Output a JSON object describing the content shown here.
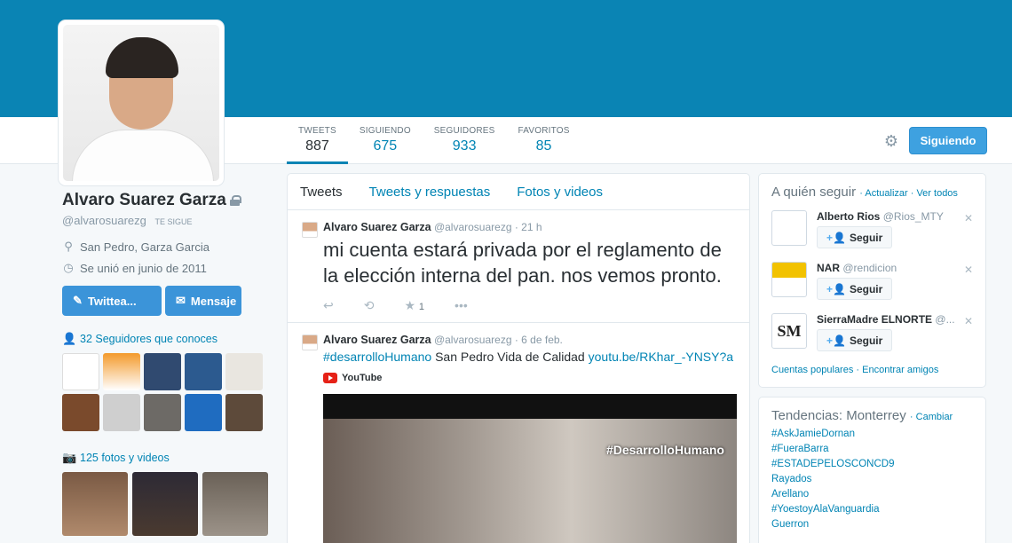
{
  "colors": {
    "banner": "#0a84b4",
    "accent": "#0084b4",
    "button": "#3b94d9"
  },
  "profile": {
    "name": "Alvaro Suarez Garza",
    "handle": "@alvarosuarezg",
    "follows_you": "TE SIGUE",
    "location": "San Pedro, Garza Garcia",
    "joined": "Se unió en junio de 2011",
    "tweet_button": "Twittea...",
    "message_button": "Mensaje",
    "known_followers": "32 Seguidores que conoces",
    "photos_videos": "125 fotos y videos"
  },
  "stats": [
    {
      "label": "TWEETS",
      "value": "887"
    },
    {
      "label": "SIGUIENDO",
      "value": "675"
    },
    {
      "label": "SEGUIDORES",
      "value": "933"
    },
    {
      "label": "FAVORITOS",
      "value": "85"
    }
  ],
  "header": {
    "following_button": "Siguiendo",
    "settings_icon": "gear-icon"
  },
  "tabs": [
    "Tweets",
    "Tweets y respuestas",
    "Fotos y videos"
  ],
  "tweets": [
    {
      "name": "Alvaro Suarez Garza",
      "handle": "@alvarosuarezg",
      "time": "· 21 h",
      "text": "mi cuenta estará privada por el reglamento de la elección interna del pan. nos vemos pronto.",
      "favorites": "1"
    },
    {
      "name": "Alvaro Suarez Garza",
      "handle": "@alvarosuarezg",
      "time": "· 6 de feb.",
      "hashtag": "#desarrolloHumano",
      "text": "San Pedro Vida de Calidad",
      "link": "youtu.be/RKhar_-YNSY?a",
      "source": "YouTube",
      "video_tag": "#DesarrolloHumano"
    }
  ],
  "who_to_follow": {
    "title": "A quién seguir",
    "refresh": "Actualizar",
    "view_all": "Ver todos",
    "follow_label": "Seguir",
    "users": [
      {
        "name": "Alberto Rios",
        "handle": "@Rios_MTY"
      },
      {
        "name": "NAR",
        "handle": "@rendicion"
      },
      {
        "name": "SierraMadre ELNORTE",
        "handle": "@..."
      }
    ],
    "popular": "Cuentas populares",
    "find_friends": "Encontrar amigos"
  },
  "trends": {
    "title": "Tendencias: Monterrey",
    "change": "Cambiar",
    "items": [
      "#AskJamieDornan",
      "#FueraBarra",
      "#ESTADEPELOSCONCD9",
      "Rayados",
      "Arellano",
      "#YoestoyAlaVanguardia",
      "Guerron"
    ]
  }
}
